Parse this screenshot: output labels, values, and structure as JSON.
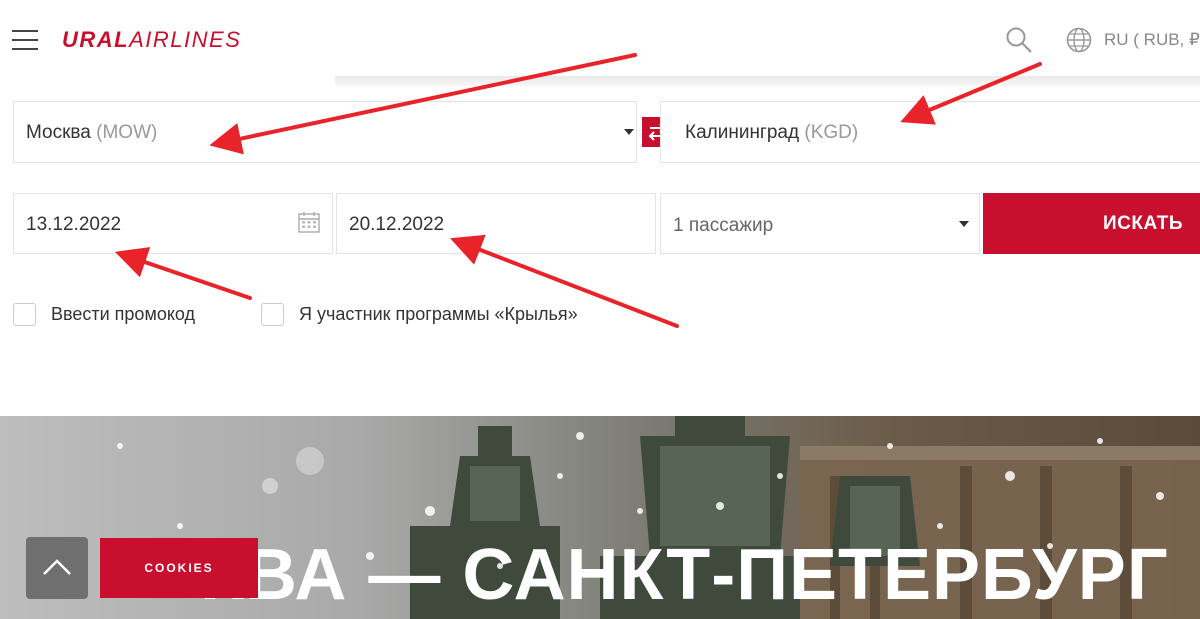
{
  "header": {
    "logo_bold": "URAL",
    "logo_thin": "AIRLINES",
    "lang_currency": "RU ( RUB, ₽"
  },
  "search_form": {
    "from": {
      "city": "Москва",
      "code": "(MOW)"
    },
    "to": {
      "city": "Калининград",
      "code": "(KGD)"
    },
    "depart_date": "13.12.2022",
    "return_date": "20.12.2022",
    "passengers": "1 пассажир",
    "search_label": "ИСКАТЬ",
    "promo_label": "Ввести промокод",
    "loyalty_label": "Я участник программы «Крылья»"
  },
  "banner": {
    "title": "КВА — САНКТ-ПЕТЕРБУРГ"
  },
  "cookies_label": "COOKIES",
  "colors": {
    "brand_red": "#c8102e",
    "annotation_red": "#e8232a"
  },
  "icons": [
    "menu-icon",
    "search-icon",
    "globe-icon",
    "swap-icon",
    "calendar-icon",
    "chevron-down-icon",
    "chevron-up-icon"
  ]
}
